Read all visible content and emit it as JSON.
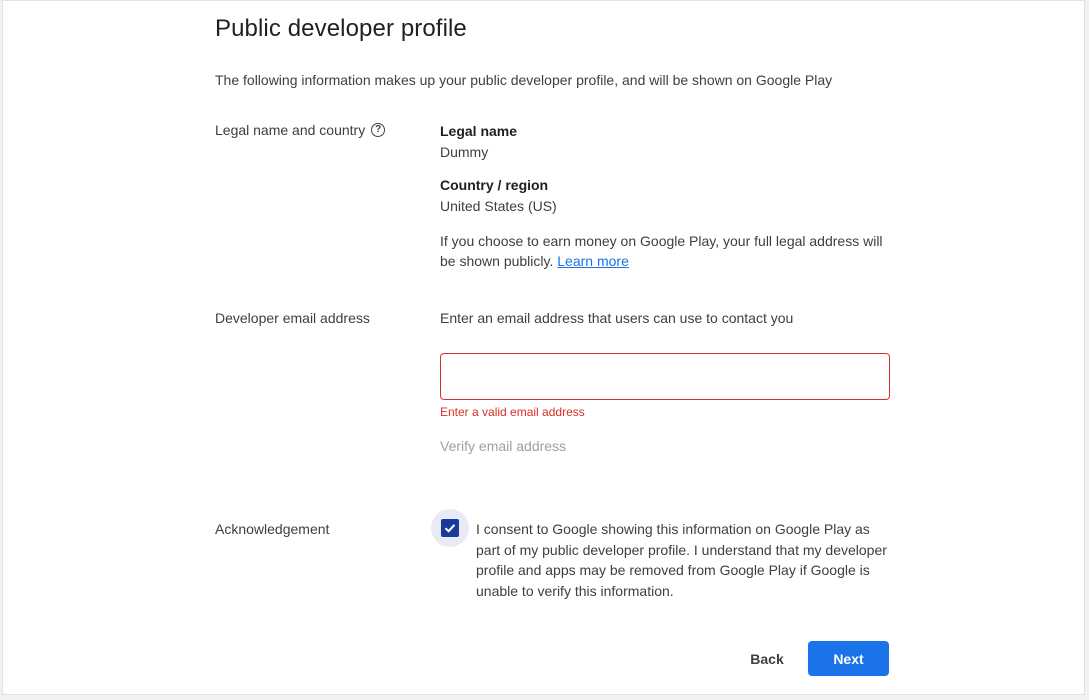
{
  "page": {
    "title": "Public developer profile",
    "intro": "The following information makes up your public developer profile, and will be shown on Google Play"
  },
  "legal": {
    "row_label": "Legal name and country",
    "help_icon": "help-circle-icon",
    "name_label": "Legal name",
    "name_value": "Dummy",
    "country_label": "Country / region",
    "country_value": "United States (US)",
    "note_text": "If you choose to earn money on Google Play, your full legal address will be shown publicly.",
    "learn_more": "Learn more"
  },
  "email": {
    "row_label": "Developer email address",
    "description": "Enter an email address that users can use to contact you",
    "value": "",
    "placeholder": "",
    "error": "Enter a valid email address",
    "verify_label": "Verify email address"
  },
  "acknowledgement": {
    "row_label": "Acknowledgement",
    "checked": true,
    "consent_text": "I consent to Google showing this information on Google Play as part of my public developer profile. I understand that my developer profile and apps may be removed from Google Play if Google is unable to verify this information."
  },
  "actions": {
    "back_label": "Back",
    "next_label": "Next"
  },
  "colors": {
    "accent": "#1a73e8",
    "error": "#d93025",
    "checkbox": "#1a3b9b"
  }
}
